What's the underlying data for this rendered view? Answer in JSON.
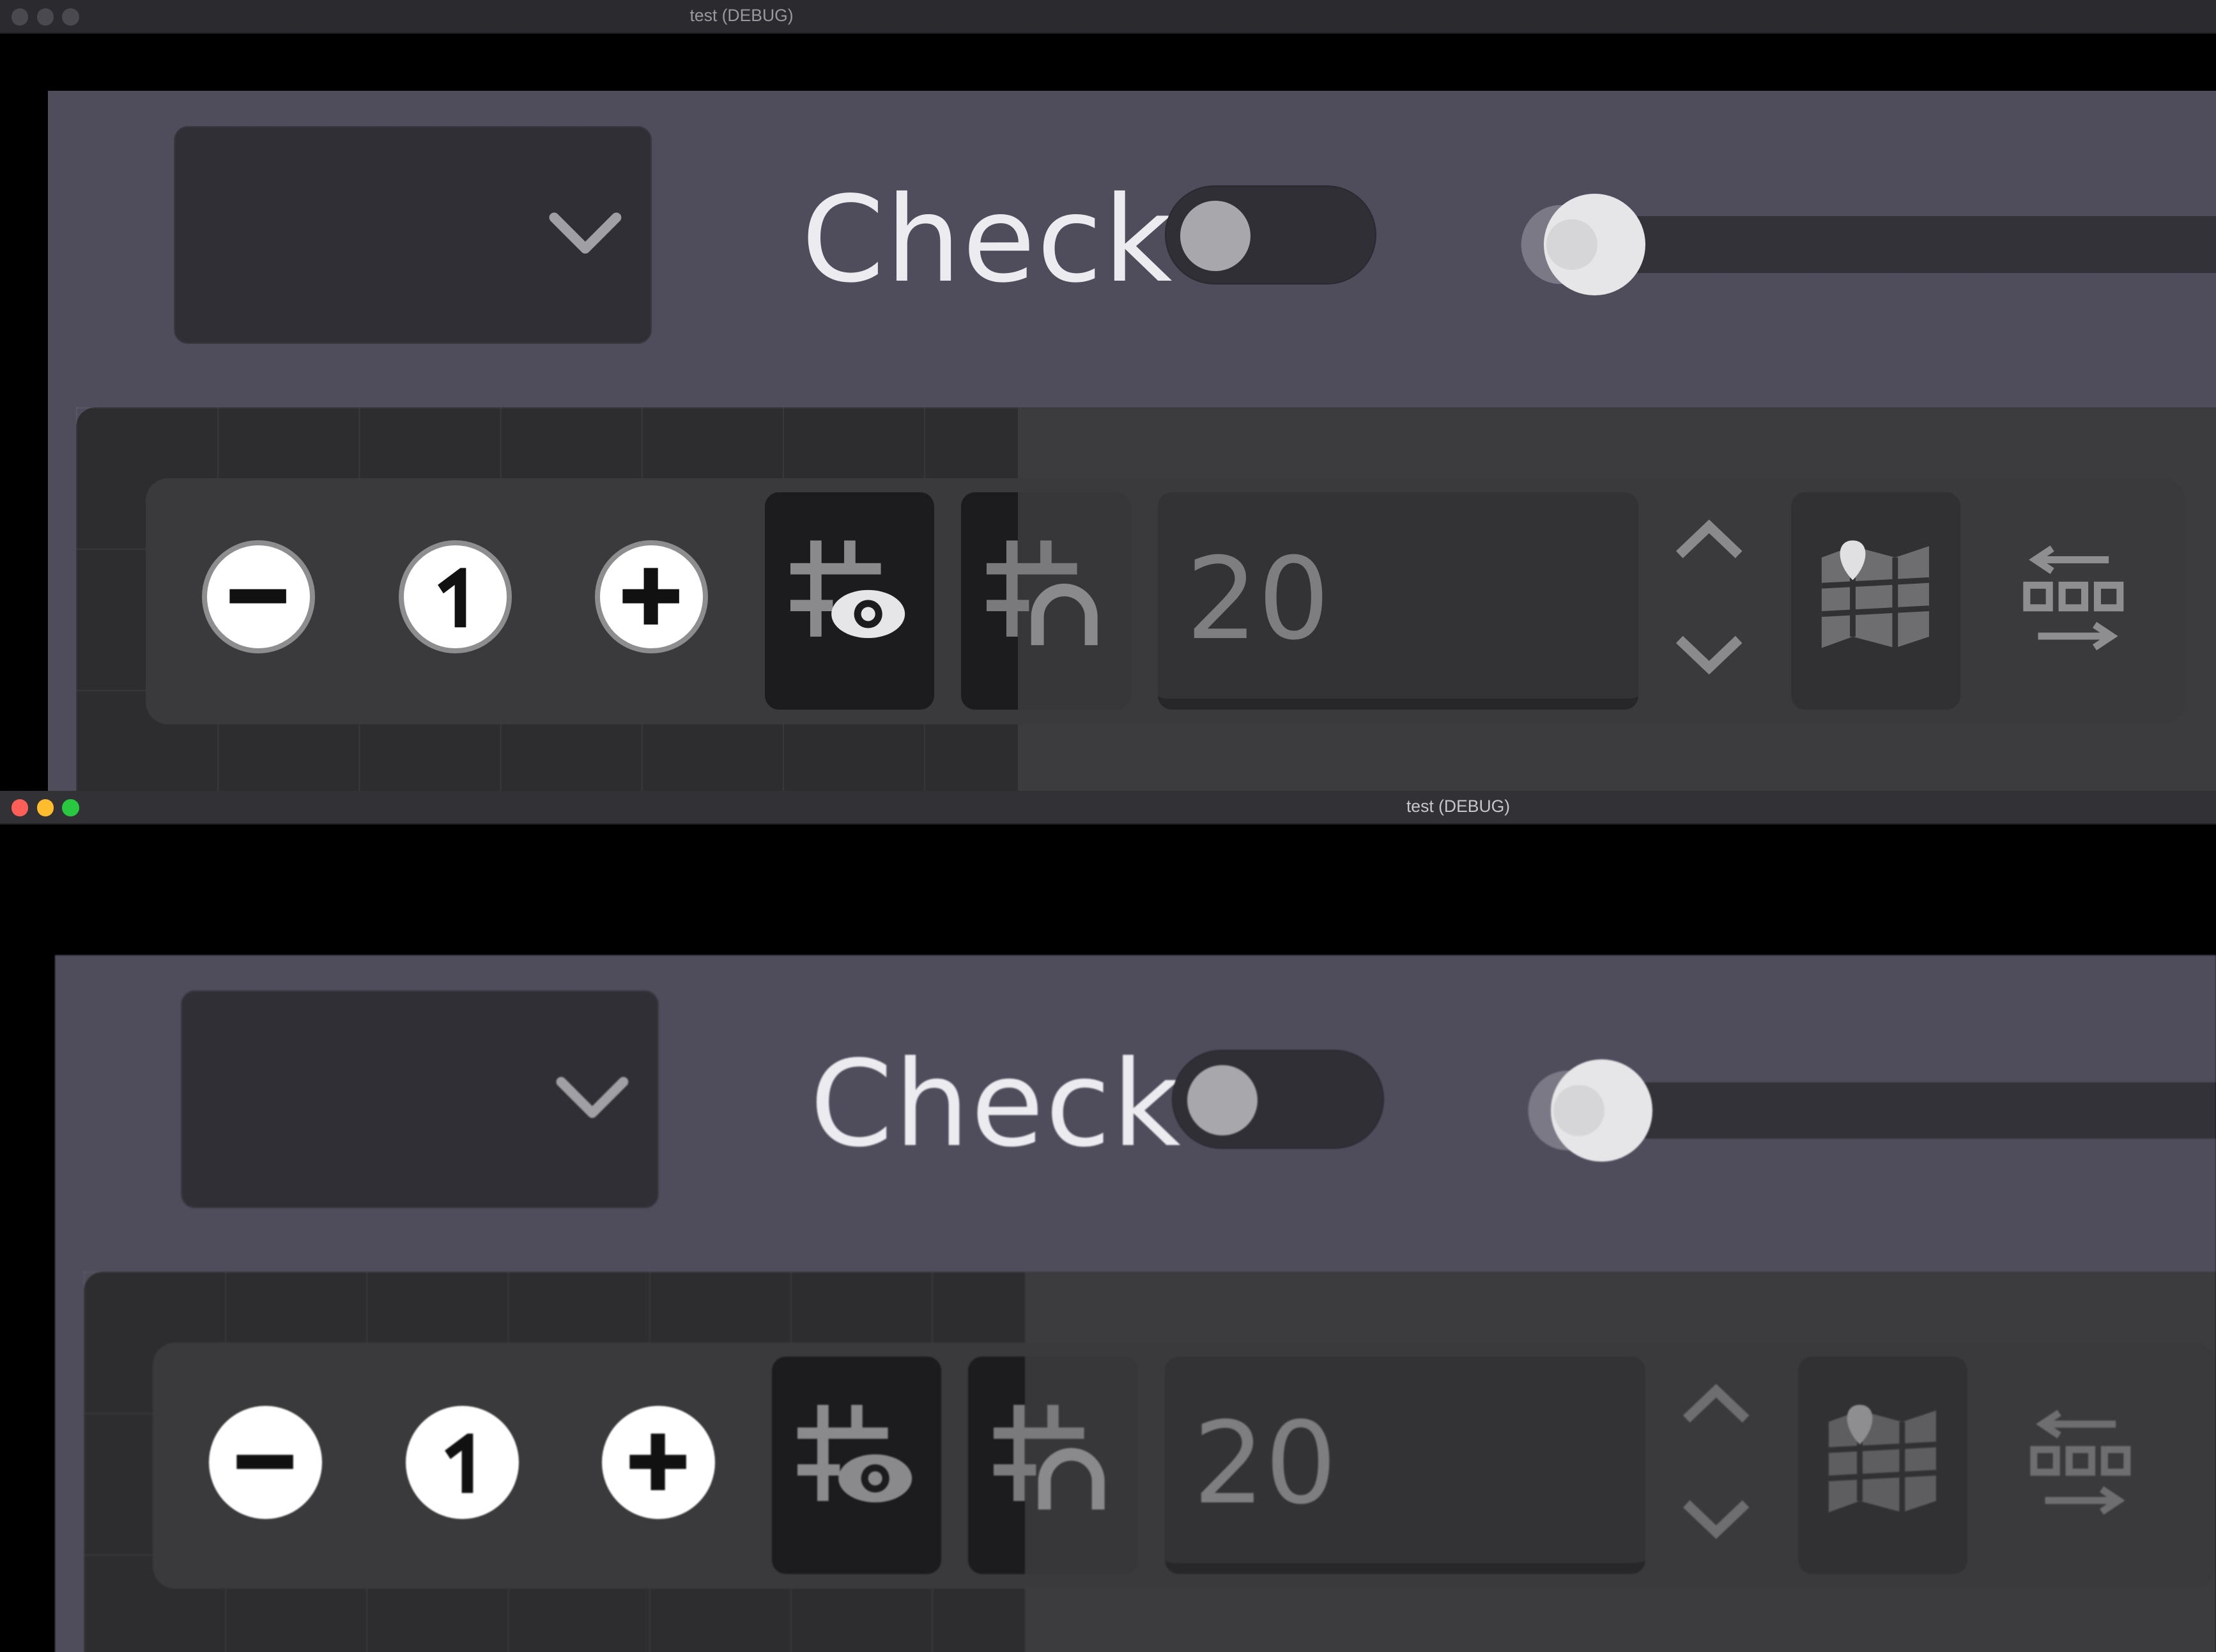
{
  "windows": [
    {
      "title": "test (DEBUG)",
      "check_label": "Check",
      "spinbox_value": "20",
      "zoom_buttons": {
        "minus": "−",
        "reset": "1",
        "plus": "+"
      }
    },
    {
      "title": "test (DEBUG)",
      "check_label": "Check",
      "spinbox_value": "20",
      "zoom_buttons": {
        "minus": "−",
        "reset": "1",
        "plus": "+"
      }
    }
  ],
  "colors": {
    "panel": "#4f4d5c",
    "control_bg": "#302f36",
    "graph_bg": "#2d2d30",
    "traffic_red": "#ff5f57",
    "traffic_yellow": "#febc2e",
    "traffic_green": "#28c840",
    "traffic_inactive": "#4a494f"
  }
}
